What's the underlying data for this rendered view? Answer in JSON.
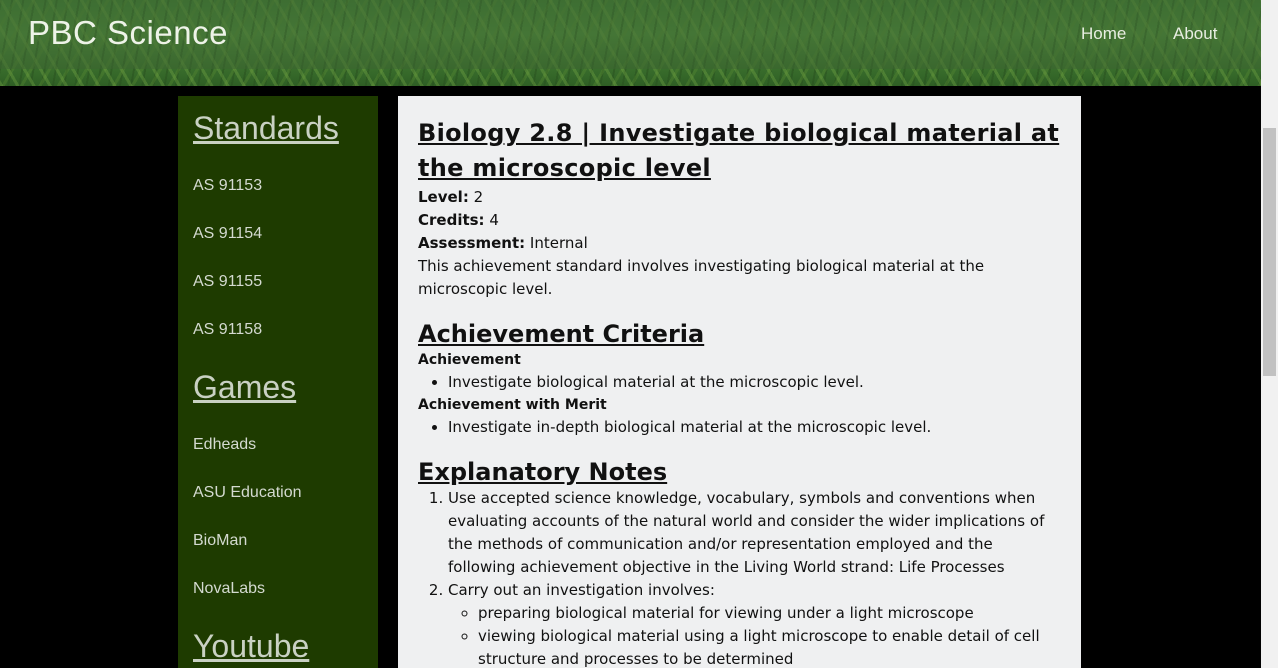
{
  "header": {
    "site_title": "PBC Science",
    "nav": [
      "Home",
      "About"
    ]
  },
  "sidebar": {
    "standards_heading": "Standards",
    "standards": [
      "AS 91153",
      "AS 91154",
      "AS 91155",
      "AS 91158"
    ],
    "games_heading": "Games",
    "games": [
      "Edheads",
      "ASU Education",
      "BioMan",
      "NovaLabs"
    ],
    "youtube_heading": "Youtube"
  },
  "main": {
    "title": "Biology 2.8 | Investigate biological material at the microscopic level",
    "level_label": "Level:",
    "level_value": " 2",
    "credits_label": "Credits:",
    "credits_value": " 4",
    "assessment_label": "Assessment:",
    "assessment_value": " Internal",
    "description": "This achievement standard involves investigating biological material at the microscopic level.",
    "criteria_heading": "Achievement Criteria",
    "criteria": [
      {
        "label": "Achievement",
        "item": "Investigate biological material at the microscopic level."
      },
      {
        "label": "Achievement with Merit",
        "item": "Investigate in-depth biological material at the microscopic level."
      }
    ],
    "notes_heading": "Explanatory Notes",
    "notes": [
      "Use accepted science knowledge, vocabulary, symbols and conventions when evaluating accounts of the natural world and consider the wider implications of the methods of communication and/or representation employed and the following achievement objective in the Living World strand: Life Processes",
      "Carry out an investigation involves:"
    ],
    "sub_notes": [
      "preparing biological material for viewing under a light microscope",
      "viewing biological material using a light microscope to enable detail of cell structure and processes to be determined"
    ]
  }
}
